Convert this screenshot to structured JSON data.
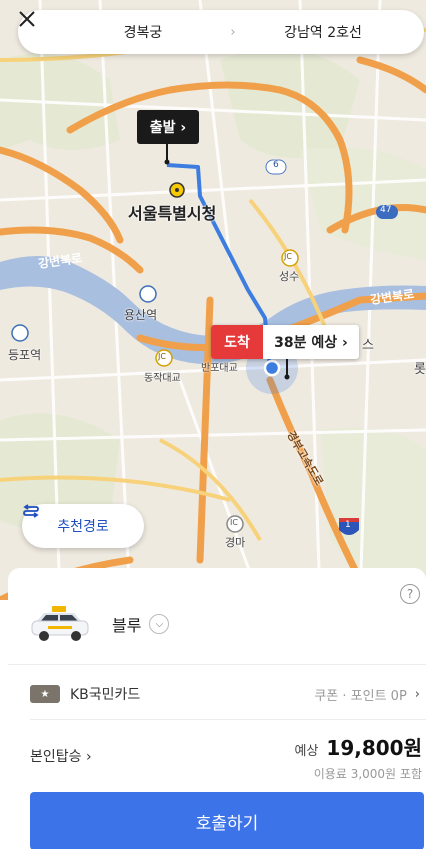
{
  "header": {
    "origin": "경복궁",
    "arrow": "›",
    "destination": "강남역 2호선"
  },
  "map": {
    "labels": {
      "city_hall": "서울특별시청",
      "yongsan": "용산역",
      "seongsu": "성수",
      "yeongdeungpo": "등포역",
      "dongjak": "동작대교",
      "banpo": "반포대교",
      "gangbyeon_north": "강변북로",
      "gangbyeon_north_east": "강변북로",
      "gyeongbu": "경부고속도로",
      "gyeongma": "경마",
      "jc1": "JC",
      "jc2": "JC",
      "ic": "IC",
      "route6": "6",
      "route47": "47",
      "route1": "1",
      "edge_su": "스",
      "edge_rot": "롯"
    }
  },
  "markers": {
    "start_label": "출발 ›",
    "arrive_label": "도착",
    "eta": "38분 예상 ›"
  },
  "recommend_route": "추천경로",
  "taxi": {
    "type_name": "블루"
  },
  "help": "?",
  "payment": {
    "card_name": "KB국민카드",
    "coupon": "쿠폰 · 포인트 0P"
  },
  "self_boarding": "본인탑승 ›",
  "price": {
    "estimate_label": "예상",
    "value": "19,800원",
    "note": "이용료 3,000원 포함"
  },
  "call_button": "호출하기",
  "colors": {
    "route_line": "#3d7de0",
    "arrive_red": "#e63a3a",
    "call_button": "#3d73e8",
    "river": "#a9bfe0",
    "road_major": "#f0a04a"
  }
}
